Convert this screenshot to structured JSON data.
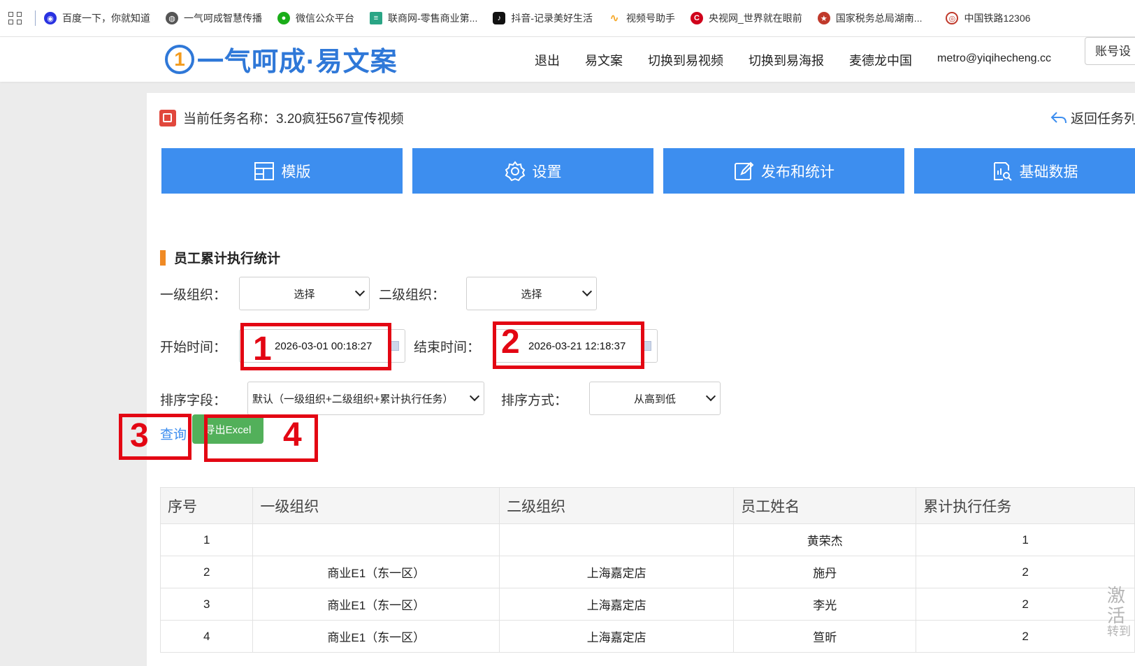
{
  "bookmarks": [
    {
      "label": "百度一下，你就知道",
      "icon": "paw-icon",
      "color": "#2932e1"
    },
    {
      "label": "一气呵成智慧传播",
      "icon": "globe-icon",
      "color": "#555555"
    },
    {
      "label": "微信公众平台",
      "icon": "wechat-icon",
      "color": "#1aad19"
    },
    {
      "label": "联商网-零售商业第...",
      "icon": "news-icon",
      "color": "#2aa585"
    },
    {
      "label": "抖音-记录美好生活",
      "icon": "tiktok-icon",
      "color": "#111111"
    },
    {
      "label": "视频号助手",
      "icon": "channels-icon",
      "color": "#f5a623"
    },
    {
      "label": "央视网_世界就在眼前",
      "icon": "cctv-icon",
      "color": "#d0021b"
    },
    {
      "label": "国家税务总局湖南...",
      "icon": "emblem-icon",
      "color": "#c0392b"
    },
    {
      "label": "中国铁路12306",
      "icon": "rail-icon",
      "color": "#c0392b"
    }
  ],
  "header": {
    "logo_mark": "1",
    "logo_text": "一气呵成·易文案",
    "nav": [
      "退出",
      "易文案",
      "切换到易视频",
      "切换到易海报",
      "麦德龙中国",
      "metro@yiqihecheng.cc"
    ],
    "account_button": "账号设"
  },
  "task": {
    "label": "当前任务名称：3.20疯狂567宣传视频",
    "back_link": "返回任务列"
  },
  "tabs": [
    {
      "label": "模版",
      "icon": "template-icon"
    },
    {
      "label": "设置",
      "icon": "gear-icon"
    },
    {
      "label": "发布和统计",
      "icon": "edit-icon"
    },
    {
      "label": "基础数据",
      "icon": "data-report-icon"
    }
  ],
  "section_title": "员工累计执行统计",
  "filters": {
    "org1_label": "一级组织：",
    "org1_value": "选择",
    "org2_label": "二级组织：",
    "org2_value": "选择",
    "start_label": "开始时间：",
    "start_value": "2026-03-01 00:18:27",
    "end_label": "结束时间：",
    "end_value": "2026-03-21 12:18:37",
    "sort_field_label": "排序字段：",
    "sort_field_value": "默认（一级组织+二级组织+累计执行任务）",
    "sort_order_label": "排序方式：",
    "sort_order_value": "从高到低"
  },
  "actions": {
    "query": "查询",
    "export": "导出Excel"
  },
  "annotations": [
    "1",
    "2",
    "3",
    "4"
  ],
  "annotation_color": "#e30613",
  "table": {
    "headers": [
      "序号",
      "一级组织",
      "二级组织",
      "员工姓名",
      "累计执行任务"
    ],
    "rows": [
      [
        "1",
        "",
        "",
        "黄荣杰",
        "1"
      ],
      [
        "2",
        "商业E1（东一区）",
        "上海嘉定店",
        "施丹",
        "2"
      ],
      [
        "3",
        "商业E1（东一区）",
        "上海嘉定店",
        "李光",
        "2"
      ],
      [
        "4",
        "商业E1（东一区）",
        "上海嘉定店",
        "笪昕",
        "2"
      ]
    ]
  },
  "watermark": {
    "line1": "激活",
    "line2": "转到"
  }
}
